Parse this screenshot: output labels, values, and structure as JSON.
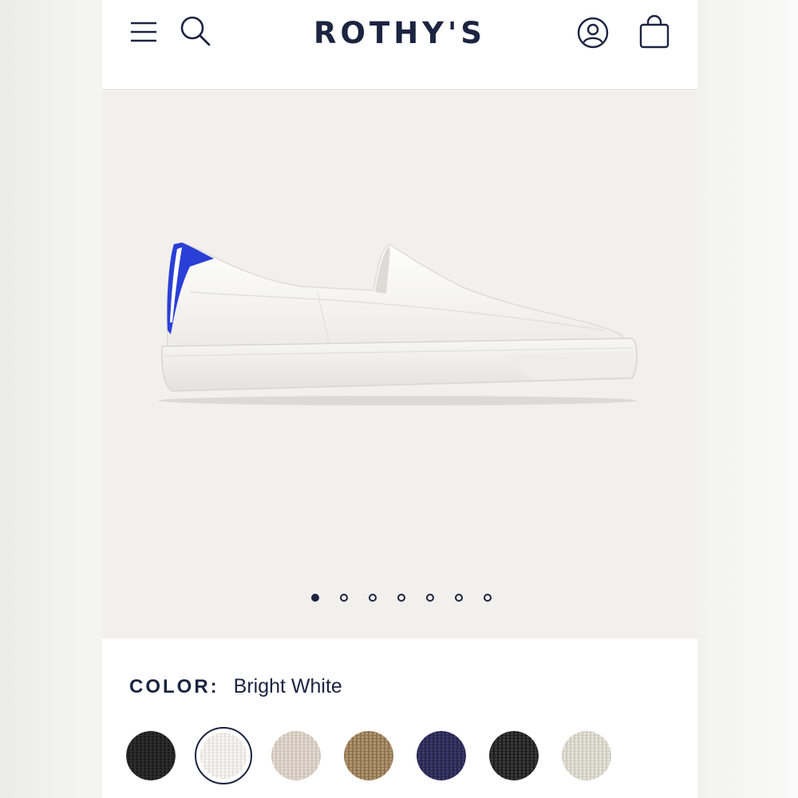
{
  "header": {
    "brand": "ROTHY'S",
    "icons": [
      "menu-icon",
      "search-icon",
      "account-icon",
      "shopping-bag-icon"
    ]
  },
  "carousel": {
    "total_slides": 7,
    "active_slide": 1
  },
  "product": {
    "color_label": "COLOR:",
    "color_value": "Bright White"
  },
  "swatches": [
    {
      "color": "#1b1b1b",
      "texture": "#2e2e2e",
      "selected": false
    },
    {
      "color": "#f7f6f3",
      "texture": "#e6e4df",
      "selected": true
    },
    {
      "color": "#e4dbd1",
      "texture": "#cfc4b8",
      "selected": false
    },
    {
      "color": "#b3966f",
      "texture": "#8e7352",
      "selected": false
    },
    {
      "color": "#3b3a6a",
      "texture": "#27264d",
      "selected": false
    },
    {
      "color": "#3a3a3a",
      "texture": "#1e1e1e",
      "selected": false
    },
    {
      "color": "#e6e4da",
      "texture": "#cfccbf",
      "selected": false
    }
  ],
  "colors": {
    "brand_navy": "#1b2440",
    "hero_bg": "#f1f0ed",
    "accent_blue": "#2a3fd6"
  }
}
